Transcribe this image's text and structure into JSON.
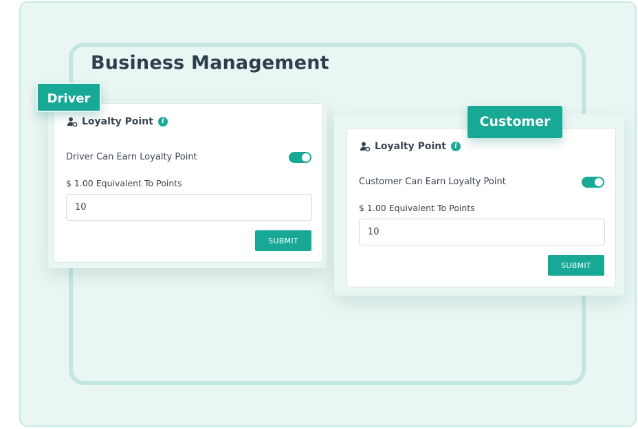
{
  "page": {
    "title": "Business Management"
  },
  "colors": {
    "accent": "#17a996",
    "background": "#e9f6f4",
    "frame": "#c2e7e1"
  },
  "driver": {
    "tag": "Driver",
    "card_title": "Loyalty Point",
    "title_icon": "user-gear-icon",
    "info_icon": "info-icon",
    "earn_label": "Driver Can Earn Loyalty Point",
    "earn_enabled": true,
    "equiv_label": "$ 1.00 Equivalent To Points",
    "points_value": "10",
    "submit_label": "SUBMIT"
  },
  "customer": {
    "tag": "Customer",
    "card_title": "Loyalty Point",
    "title_icon": "user-gear-icon",
    "info_icon": "info-icon",
    "earn_label": "Customer Can Earn Loyalty Point",
    "earn_enabled": true,
    "equiv_label": "$ 1.00 Equivalent To Points",
    "points_value": "10",
    "submit_label": "SUBMIT"
  }
}
